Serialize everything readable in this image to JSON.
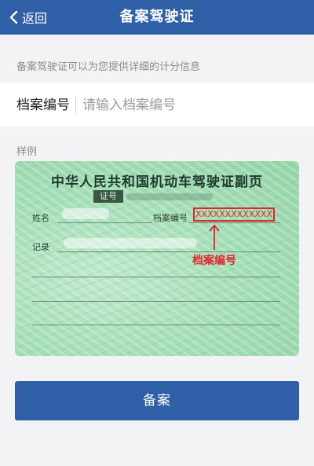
{
  "nav": {
    "back_label": "返回",
    "title": "备案驾驶证"
  },
  "hint_text": "备案驾驶证可以为您提供详细的计分信息",
  "form": {
    "label": "档案编号",
    "placeholder": "请输入档案编号",
    "value": ""
  },
  "sample": {
    "label": "样例",
    "card_title": "中华人民共和国机动车驾驶证副页",
    "cert_no_label": "证号",
    "name_label": "姓名",
    "file_no_label": "档案编号",
    "file_no_value": "XXXXXXXXXXXXX",
    "record_label": "记录",
    "annotation": "档案编号"
  },
  "submit_label": "备案",
  "colors": {
    "primary": "#2f5fa6",
    "highlight": "#e0262a"
  },
  "icons": {
    "back": "chevron-left-icon",
    "arrow": "arrow-up-icon"
  }
}
